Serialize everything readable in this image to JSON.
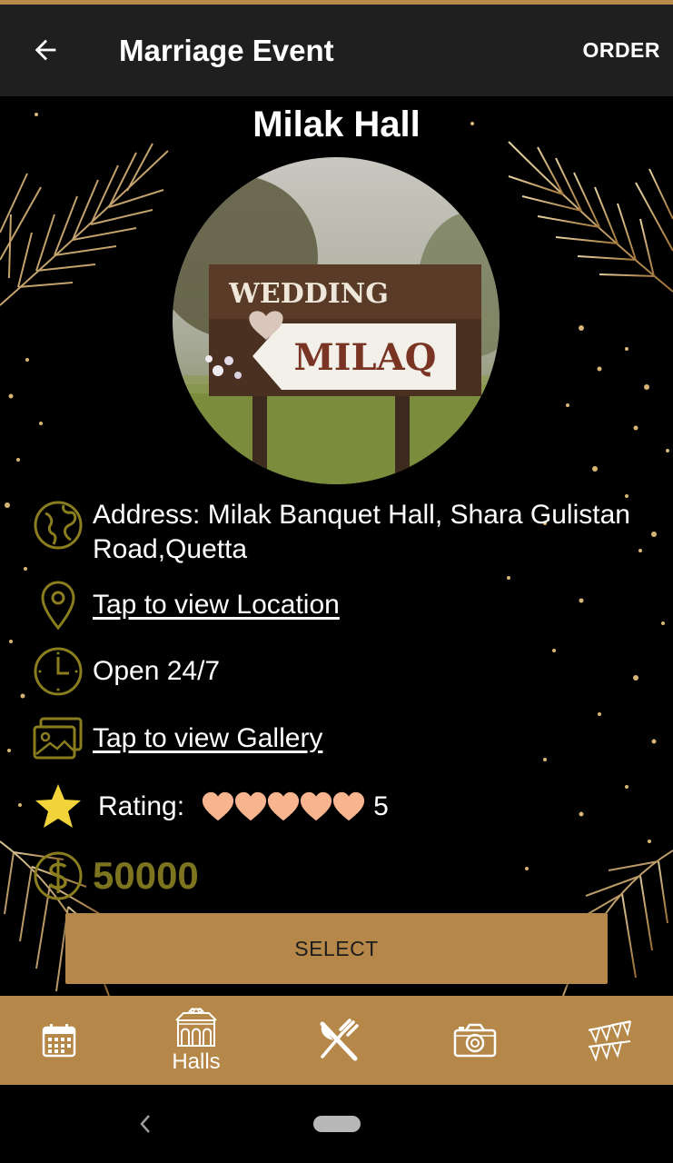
{
  "app_bar": {
    "title": "Marriage Event",
    "action_label": "ORDER",
    "back_icon": "arrow-left-icon"
  },
  "hall": {
    "name": "Milak Hall",
    "photo_sign_top": "WEDDING",
    "photo_sign_arrow": "MILAQ",
    "address": "Address: Milak Banquet Hall, Shara Gulistan Road,Quetta",
    "location_link": "Tap to view Location",
    "hours": "Open 24/7",
    "gallery_link": "Tap to view Gallery",
    "rating_label": "Rating:",
    "rating_value": "5",
    "rating_hearts": 5,
    "price": "50000"
  },
  "select_button": {
    "label": "SELECT"
  },
  "bottom_nav": {
    "items": [
      {
        "icon": "calendar-icon",
        "label": ""
      },
      {
        "icon": "hall-building-icon",
        "label": "Halls"
      },
      {
        "icon": "fork-knife-icon",
        "label": ""
      },
      {
        "icon": "camera-icon",
        "label": ""
      },
      {
        "icon": "bunting-icon",
        "label": ""
      }
    ]
  },
  "colors": {
    "accent_gold": "#b5884a",
    "icon_olive": "#8a7d1e",
    "price_olive": "#7d7420",
    "heart_peach": "#f7b48e",
    "star_yellow": "#f2d43a",
    "app_bar_bg": "#1f1f1f"
  }
}
